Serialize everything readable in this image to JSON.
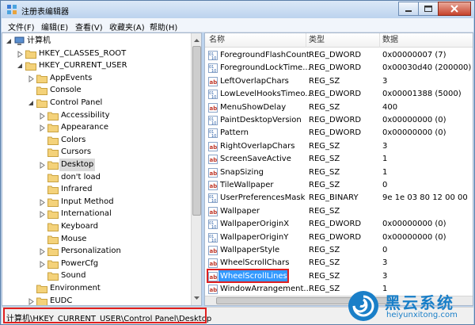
{
  "window": {
    "title": "注册表编辑器"
  },
  "menu": [
    "文件(F)",
    "编辑(E)",
    "查看(V)",
    "收藏夹(A)",
    "帮助(H)"
  ],
  "tree": {
    "root": "计算机",
    "items": [
      {
        "label": "HKEY_CLASSES_ROOT"
      },
      {
        "label": "HKEY_CURRENT_USER"
      },
      {
        "label": "AppEvents"
      },
      {
        "label": "Console"
      },
      {
        "label": "Control Panel"
      },
      {
        "label": "Accessibility"
      },
      {
        "label": "Appearance"
      },
      {
        "label": "Colors"
      },
      {
        "label": "Cursors"
      },
      {
        "label": "Desktop"
      },
      {
        "label": "don't load"
      },
      {
        "label": "Infrared"
      },
      {
        "label": "Input Method"
      },
      {
        "label": "International"
      },
      {
        "label": "Keyboard"
      },
      {
        "label": "Mouse"
      },
      {
        "label": "Personalization"
      },
      {
        "label": "PowerCfg"
      },
      {
        "label": "Sound"
      },
      {
        "label": "Environment"
      },
      {
        "label": "EUDC"
      }
    ]
  },
  "list": {
    "headers": {
      "name": "名称",
      "type": "类型",
      "data": "数据"
    },
    "rows": [
      {
        "name": "ForegroundFlashCount",
        "type": "REG_DWORD",
        "data": "0x00000007 (7)",
        "icon": "dword-icon"
      },
      {
        "name": "ForegroundLockTime...",
        "type": "REG_DWORD",
        "data": "0x00030d40 (200000)",
        "icon": "dword-icon"
      },
      {
        "name": "LeftOverlapChars",
        "type": "REG_SZ",
        "data": "3",
        "icon": "string-icon"
      },
      {
        "name": "LowLevelHooksTimeo...",
        "type": "REG_DWORD",
        "data": "0x00001388 (5000)",
        "icon": "dword-icon"
      },
      {
        "name": "MenuShowDelay",
        "type": "REG_SZ",
        "data": "400",
        "icon": "string-icon"
      },
      {
        "name": "PaintDesktopVersion",
        "type": "REG_DWORD",
        "data": "0x00000000 (0)",
        "icon": "dword-icon"
      },
      {
        "name": "Pattern",
        "type": "REG_DWORD",
        "data": "0x00000000 (0)",
        "icon": "dword-icon"
      },
      {
        "name": "RightOverlapChars",
        "type": "REG_SZ",
        "data": "3",
        "icon": "string-icon"
      },
      {
        "name": "ScreenSaveActive",
        "type": "REG_SZ",
        "data": "1",
        "icon": "string-icon"
      },
      {
        "name": "SnapSizing",
        "type": "REG_SZ",
        "data": "1",
        "icon": "string-icon"
      },
      {
        "name": "TileWallpaper",
        "type": "REG_SZ",
        "data": "0",
        "icon": "string-icon"
      },
      {
        "name": "UserPreferencesMask",
        "type": "REG_BINARY",
        "data": "9e 1e 03 80 12 00 00",
        "icon": "binary-icon"
      },
      {
        "name": "Wallpaper",
        "type": "REG_SZ",
        "data": "",
        "icon": "string-icon"
      },
      {
        "name": "WallpaperOriginX",
        "type": "REG_DWORD",
        "data": "0x00000000 (0)",
        "icon": "dword-icon"
      },
      {
        "name": "WallpaperOriginY",
        "type": "REG_DWORD",
        "data": "0x00000000 (0)",
        "icon": "dword-icon"
      },
      {
        "name": "WallpaperStyle",
        "type": "REG_SZ",
        "data": "0",
        "icon": "string-icon"
      },
      {
        "name": "WheelScrollChars",
        "type": "REG_SZ",
        "data": "3",
        "icon": "string-icon"
      },
      {
        "name": "WheelScrollLines",
        "type": "REG_SZ",
        "data": "3",
        "icon": "string-icon"
      },
      {
        "name": "WindowArrangement...",
        "type": "REG_SZ",
        "data": "1",
        "icon": "string-icon"
      }
    ]
  },
  "status": {
    "path": "计算机\\HKEY_CURRENT_USER\\Control Panel\\Desktop"
  },
  "watermark": {
    "title": "黑云系统",
    "url": "heiyunxitong.com"
  },
  "colors": {
    "selection": "#3399ff",
    "highlight_box": "#e02020",
    "watermark": "#1a7fc8"
  }
}
